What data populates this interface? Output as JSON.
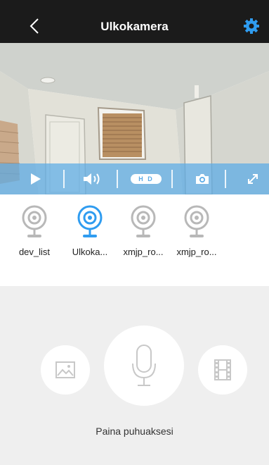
{
  "header": {
    "title": "Ulkokamera",
    "back_icon": "chevron-left-icon",
    "settings_icon": "gear-icon",
    "accent_color": "#2f9cf0"
  },
  "controls": {
    "play_icon": "play-icon",
    "volume_icon": "speaker-icon",
    "quality_label": "H D",
    "snapshot_icon": "camera-icon",
    "fullscreen_icon": "expand-icon",
    "bar_color": "#5aaae6"
  },
  "devices": [
    {
      "label": "dev_list",
      "selected": false
    },
    {
      "label": "Ulkoka...",
      "selected": true
    },
    {
      "label": "xmjp_ro...",
      "selected": false
    },
    {
      "label": "xmjp_ro...",
      "selected": false
    }
  ],
  "talk": {
    "gallery_icon": "image-icon",
    "mic_icon": "microphone-icon",
    "video_icon": "film-icon",
    "hint": "Paina puhuaksesi"
  }
}
